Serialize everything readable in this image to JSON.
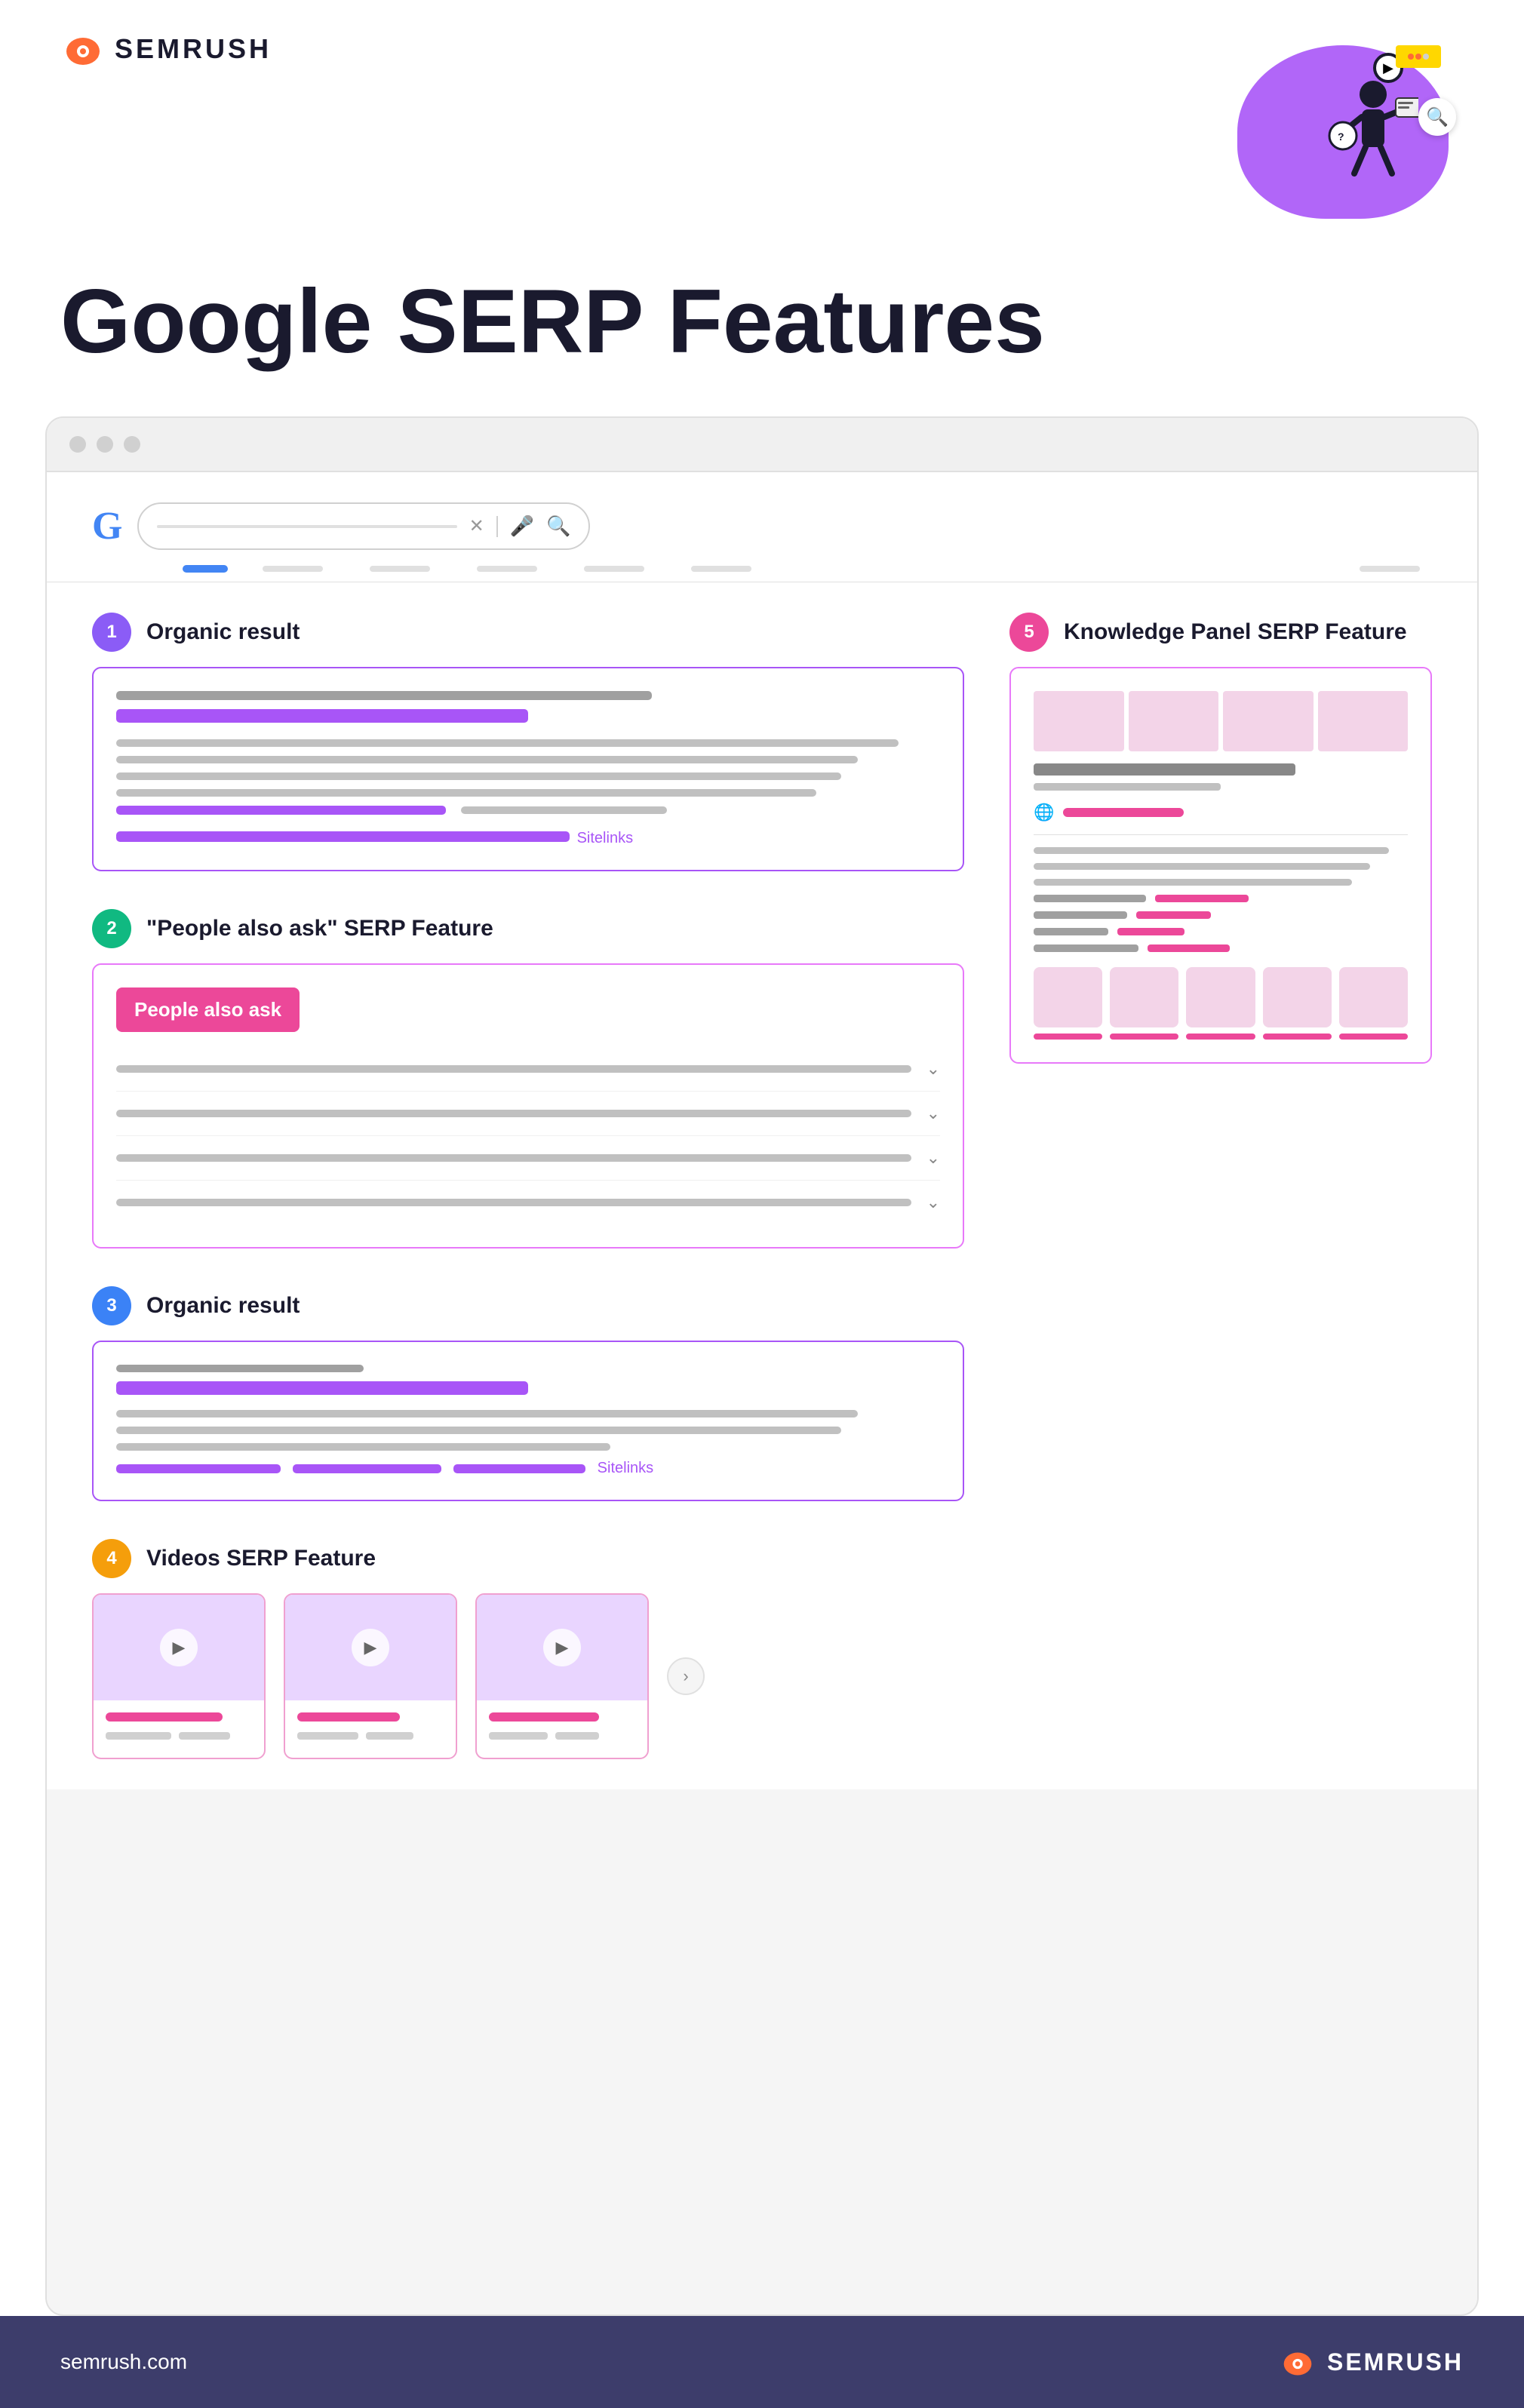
{
  "header": {
    "logo_text": "SEMRUSH",
    "page_title": "Google SERP Features"
  },
  "browser": {
    "search_placeholder": ""
  },
  "serp": {
    "sections": [
      {
        "number": "1",
        "label": "Organic result",
        "type": "organic",
        "sitelinks_label": "Sitelinks"
      },
      {
        "number": "2",
        "label": "\"People also ask\" SERP Feature",
        "type": "paa",
        "paa_label": "People also ask"
      },
      {
        "number": "3",
        "label": "Organic result",
        "type": "organic2",
        "sitelinks_label": "Sitelinks"
      },
      {
        "number": "4",
        "label": "Videos SERP Feature",
        "type": "videos"
      }
    ],
    "right_section": {
      "number": "5",
      "label": "Knowledge Panel SERP Feature"
    }
  },
  "footer": {
    "url": "semrush.com",
    "logo_text": "SEMRUSH"
  }
}
